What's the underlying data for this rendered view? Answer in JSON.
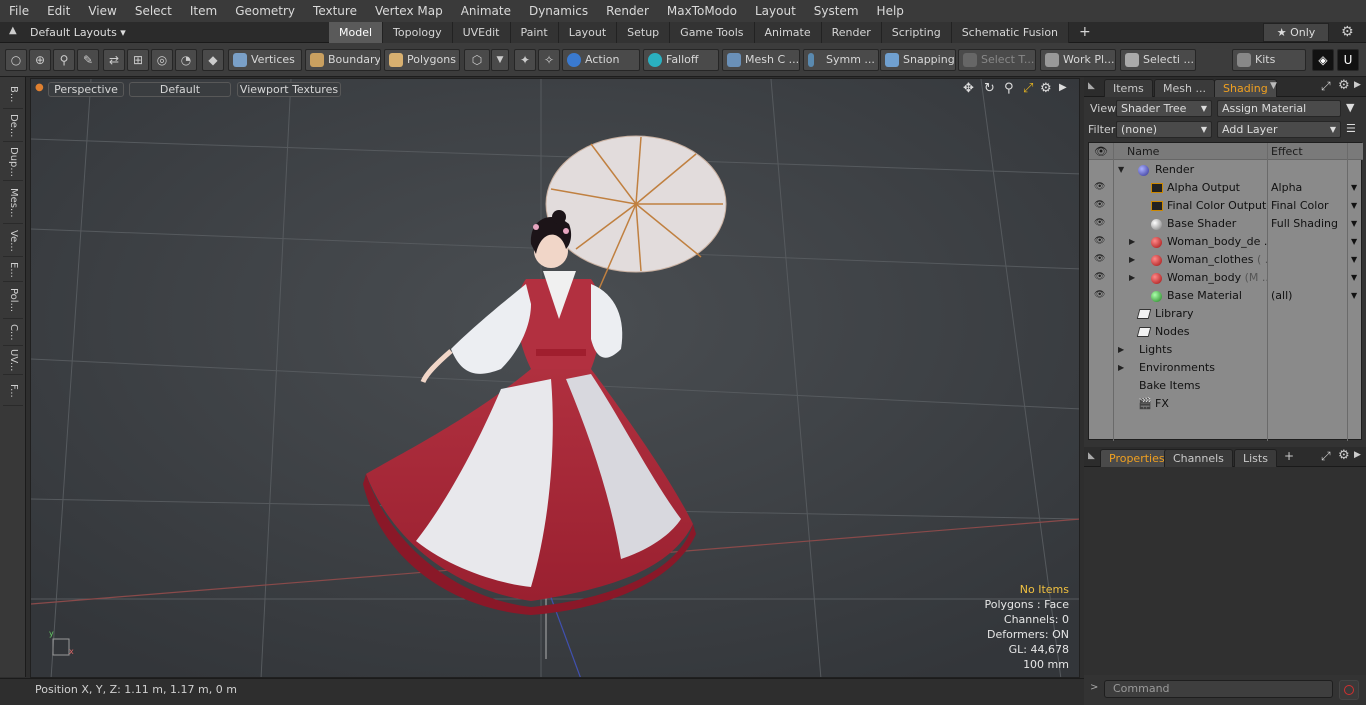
{
  "menu": [
    "File",
    "Edit",
    "View",
    "Select",
    "Item",
    "Geometry",
    "Texture",
    "Vertex Map",
    "Animate",
    "Dynamics",
    "Render",
    "MaxToModo",
    "Layout",
    "System",
    "Help"
  ],
  "layout_select": "Default Layouts ▾",
  "tabs": [
    "Model",
    "Topology",
    "UVEdit",
    "Paint",
    "Layout",
    "Setup",
    "Game Tools",
    "Animate",
    "Render",
    "Scripting",
    "Schematic Fusion"
  ],
  "tab_add": "+",
  "only_label": "★ Only",
  "toolbar": {
    "vertices": "Vertices",
    "boundary": "Boundary",
    "polygons": "Polygons",
    "action": "Action",
    "falloff": "Falloff",
    "mesh": "Mesh C ...",
    "symm": "Symm ...",
    "snapping": "Snapping",
    "select_t": "Select T...",
    "work_pl": "Work Pl...",
    "selecti": "Selecti ...",
    "kits": "Kits"
  },
  "left_tabs": [
    "B...",
    "De...",
    "Dup...",
    "Mes...",
    "Ve...",
    "E...",
    "Pol...",
    "C...",
    "UV...",
    "F..."
  ],
  "viewport": {
    "perspective": "Perspective",
    "default": "Default",
    "textures": "Viewport Textures"
  },
  "stats": {
    "items": "No Items",
    "polygons": "Polygons : Face",
    "channels": "Channels: 0",
    "deformers": "Deformers: ON",
    "gl": "GL: 44,678",
    "scale": "100 mm"
  },
  "status": "Position X, Y, Z:   1.11 m, 1.17 m, 0 m",
  "panel": {
    "tabs": [
      "Items",
      "Mesh ...",
      "Shading"
    ],
    "view_label": "View",
    "view_value": "Shader Tree",
    "assign": "Assign Material",
    "filter_label": "Filter",
    "filter_value": "(none)",
    "add_layer": "Add Layer",
    "col_name": "Name",
    "col_effect": "Effect",
    "rows": [
      {
        "name": "Render",
        "effect": ""
      },
      {
        "name": "Alpha Output",
        "effect": "Alpha"
      },
      {
        "name": "Final Color Output",
        "effect": "Final Color"
      },
      {
        "name": "Base Shader",
        "effect": "Full Shading"
      },
      {
        "name": "Woman_body_de ...",
        "effect": ""
      },
      {
        "name": "Woman_clothes",
        "dim": " ( ...",
        "effect": ""
      },
      {
        "name": "Woman_body",
        "dim": " (M ...",
        "effect": ""
      },
      {
        "name": "Base Material",
        "effect": "(all)"
      },
      {
        "name": "Library",
        "effect": ""
      },
      {
        "name": "Nodes",
        "effect": ""
      },
      {
        "name": "Lights",
        "effect": ""
      },
      {
        "name": "Environments",
        "effect": ""
      },
      {
        "name": "Bake Items",
        "effect": ""
      },
      {
        "name": "FX",
        "effect": ""
      }
    ],
    "ptabs": [
      "Properties",
      "Channels",
      "Lists"
    ],
    "command_placeholder": "Command"
  },
  "colors": {
    "accent": "#f0a020",
    "viewport_bg": "#3f4347"
  }
}
